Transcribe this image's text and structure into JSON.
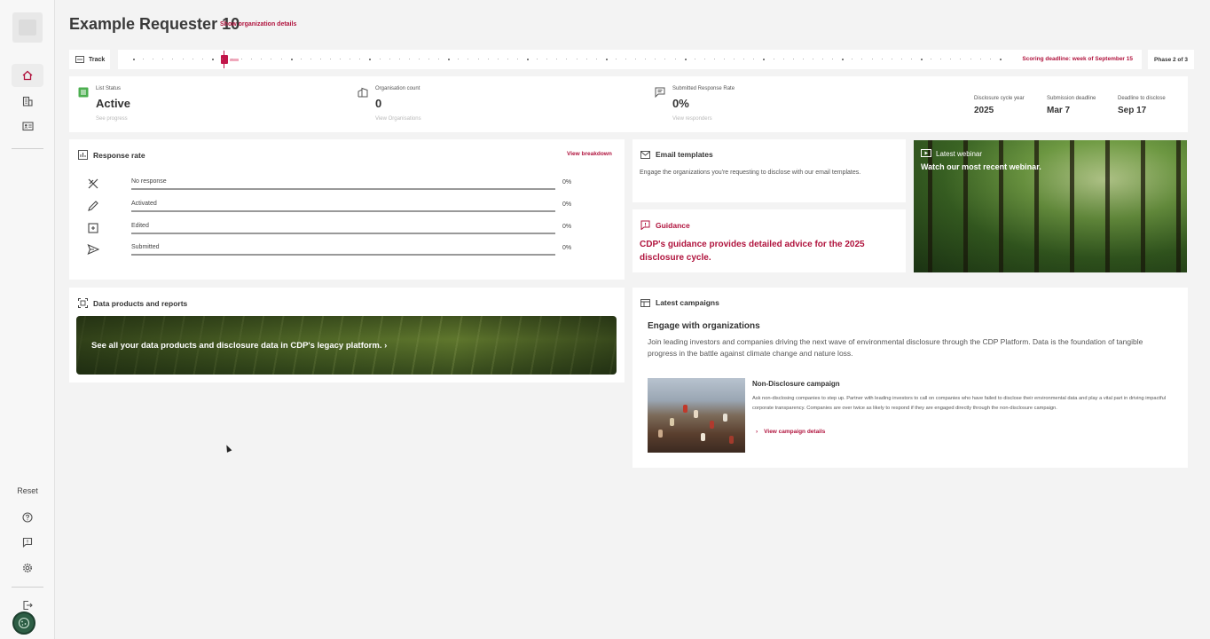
{
  "sidebar": {
    "items": [
      {
        "icon": "home-icon"
      },
      {
        "icon": "building-icon"
      },
      {
        "icon": "id-card-icon"
      }
    ],
    "reset_label": "Reset",
    "bottom_items": [
      {
        "icon": "help-icon"
      },
      {
        "icon": "feedback-icon"
      },
      {
        "icon": "gear-icon"
      },
      {
        "icon": "logout-icon"
      }
    ]
  },
  "header": {
    "title": "Example Requester 10",
    "org_link": "Show organization details"
  },
  "track": {
    "label": "Track",
    "deadline": "Scoring deadline: week of September 15",
    "phase": "Phase 2 of 3"
  },
  "stats": {
    "list_status": {
      "label": "List Status",
      "value": "Active",
      "link": "See progress"
    },
    "org_count": {
      "label": "Organisation count",
      "value": "0",
      "link": "View Organisations"
    },
    "response_rate": {
      "label": "Submitted Response Rate",
      "value": "0%",
      "link": "View responders"
    },
    "meta": [
      {
        "label": "Disclosure cycle year",
        "value": "2025"
      },
      {
        "label": "Submission deadline",
        "value": "Mar 7"
      },
      {
        "label": "Deadline to disclose",
        "value": "Sep 17"
      }
    ]
  },
  "response_rate_card": {
    "title": "Response rate",
    "link": "View breakdown",
    "rows": [
      {
        "name": "No response",
        "pct": "0%"
      },
      {
        "name": "Activated",
        "pct": "0%"
      },
      {
        "name": "Edited",
        "pct": "0%"
      },
      {
        "name": "Submitted",
        "pct": "0%"
      }
    ]
  },
  "email_card": {
    "title": "Email templates",
    "text": "Engage the organizations you're requesting to disclose with our email templates."
  },
  "guidance_card": {
    "title": "Guidance",
    "text": "CDP's guidance provides detailed advice for the 2025 disclosure cycle."
  },
  "webinar": {
    "label": "Latest webinar",
    "subtitle": "Watch our most recent webinar."
  },
  "data_products": {
    "title": "Data products and reports",
    "banner_text": "See all your data products and disclosure data in CDP's legacy platform."
  },
  "campaigns": {
    "title": "Latest campaigns",
    "engage_title": "Engage with organizations",
    "engage_text": "Join leading investors and companies driving the next wave of environmental disclosure through the CDP Platform. Data is the foundation of tangible progress in the battle against climate change and nature loss.",
    "nd_title": "Non-Disclosure campaign",
    "nd_text": "Ask non-disclosing companies to step up. Partner with leading investors to call on companies who have failed to disclose their environmental data and play a vital part in driving impactful corporate transparency. Companies are over twice as likely to respond if they are engaged directly through the non-disclosure campaign.",
    "nd_link": "View campaign details"
  },
  "colors": {
    "accent": "#b0133d",
    "background": "#f3f3f3",
    "card": "#ffffff"
  }
}
